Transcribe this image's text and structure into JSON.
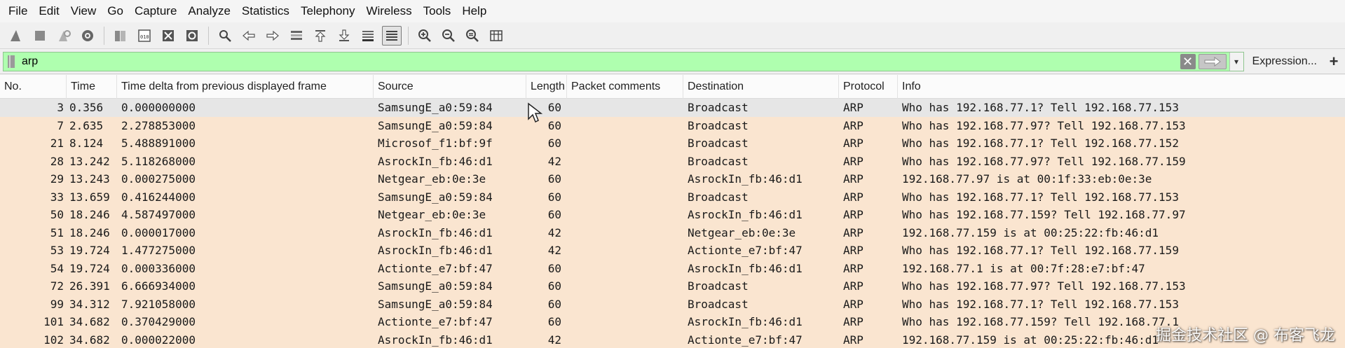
{
  "menu": [
    "File",
    "Edit",
    "View",
    "Go",
    "Capture",
    "Analyze",
    "Statistics",
    "Telephony",
    "Wireless",
    "Tools",
    "Help"
  ],
  "filter": {
    "value": "arp",
    "expression_label": "Expression...",
    "plus_label": "+"
  },
  "columns": [
    "No.",
    "Time",
    "Time delta from previous displayed frame",
    "Source",
    "Length",
    "Packet comments",
    "Destination",
    "Protocol",
    "Info"
  ],
  "packets": [
    {
      "no": "3",
      "time": "0.356",
      "delta": "0.000000000",
      "src": "SamsungE_a0:59:84",
      "len": "60",
      "comment": "",
      "dst": "Broadcast",
      "proto": "ARP",
      "info": "Who has 192.168.77.1? Tell 192.168.77.153"
    },
    {
      "no": "7",
      "time": "2.635",
      "delta": "2.278853000",
      "src": "SamsungE_a0:59:84",
      "len": "60",
      "comment": "",
      "dst": "Broadcast",
      "proto": "ARP",
      "info": "Who has 192.168.77.97? Tell 192.168.77.153"
    },
    {
      "no": "21",
      "time": "8.124",
      "delta": "5.488891000",
      "src": "Microsof_f1:bf:9f",
      "len": "60",
      "comment": "",
      "dst": "Broadcast",
      "proto": "ARP",
      "info": "Who has 192.168.77.1? Tell 192.168.77.152"
    },
    {
      "no": "28",
      "time": "13.242",
      "delta": "5.118268000",
      "src": "AsrockIn_fb:46:d1",
      "len": "42",
      "comment": "",
      "dst": "Broadcast",
      "proto": "ARP",
      "info": "Who has 192.168.77.97? Tell 192.168.77.159"
    },
    {
      "no": "29",
      "time": "13.243",
      "delta": "0.000275000",
      "src": "Netgear_eb:0e:3e",
      "len": "60",
      "comment": "",
      "dst": "AsrockIn_fb:46:d1",
      "proto": "ARP",
      "info": "192.168.77.97 is at 00:1f:33:eb:0e:3e"
    },
    {
      "no": "33",
      "time": "13.659",
      "delta": "0.416244000",
      "src": "SamsungE_a0:59:84",
      "len": "60",
      "comment": "",
      "dst": "Broadcast",
      "proto": "ARP",
      "info": "Who has 192.168.77.1? Tell 192.168.77.153"
    },
    {
      "no": "50",
      "time": "18.246",
      "delta": "4.587497000",
      "src": "Netgear_eb:0e:3e",
      "len": "60",
      "comment": "",
      "dst": "AsrockIn_fb:46:d1",
      "proto": "ARP",
      "info": "Who has 192.168.77.159? Tell 192.168.77.97"
    },
    {
      "no": "51",
      "time": "18.246",
      "delta": "0.000017000",
      "src": "AsrockIn_fb:46:d1",
      "len": "42",
      "comment": "",
      "dst": "Netgear_eb:0e:3e",
      "proto": "ARP",
      "info": "192.168.77.159 is at 00:25:22:fb:46:d1"
    },
    {
      "no": "53",
      "time": "19.724",
      "delta": "1.477275000",
      "src": "AsrockIn_fb:46:d1",
      "len": "42",
      "comment": "",
      "dst": "Actionte_e7:bf:47",
      "proto": "ARP",
      "info": "Who has 192.168.77.1? Tell 192.168.77.159"
    },
    {
      "no": "54",
      "time": "19.724",
      "delta": "0.000336000",
      "src": "Actionte_e7:bf:47",
      "len": "60",
      "comment": "",
      "dst": "AsrockIn_fb:46:d1",
      "proto": "ARP",
      "info": "192.168.77.1 is at 00:7f:28:e7:bf:47"
    },
    {
      "no": "72",
      "time": "26.391",
      "delta": "6.666934000",
      "src": "SamsungE_a0:59:84",
      "len": "60",
      "comment": "",
      "dst": "Broadcast",
      "proto": "ARP",
      "info": "Who has 192.168.77.97? Tell 192.168.77.153"
    },
    {
      "no": "99",
      "time": "34.312",
      "delta": "7.921058000",
      "src": "SamsungE_a0:59:84",
      "len": "60",
      "comment": "",
      "dst": "Broadcast",
      "proto": "ARP",
      "info": "Who has 192.168.77.1? Tell 192.168.77.153"
    },
    {
      "no": "101",
      "time": "34.682",
      "delta": "0.370429000",
      "src": "Actionte_e7:bf:47",
      "len": "60",
      "comment": "",
      "dst": "AsrockIn_fb:46:d1",
      "proto": "ARP",
      "info": "Who has 192.168.77.159? Tell 192.168.77.1"
    },
    {
      "no": "102",
      "time": "34.682",
      "delta": "0.000022000",
      "src": "AsrockIn_fb:46:d1",
      "len": "42",
      "comment": "",
      "dst": "Actionte_e7:bf:47",
      "proto": "ARP",
      "info": "192.168.77.159 is at 00:25:22:fb:46:d1"
    }
  ],
  "selected_index": 0,
  "watermark": "掘金技术社区 @ 布客飞龙",
  "colors": {
    "row_arp": "#fae5d0",
    "row_selected": "#e6e6e6",
    "filter_valid": "#afffaf"
  }
}
